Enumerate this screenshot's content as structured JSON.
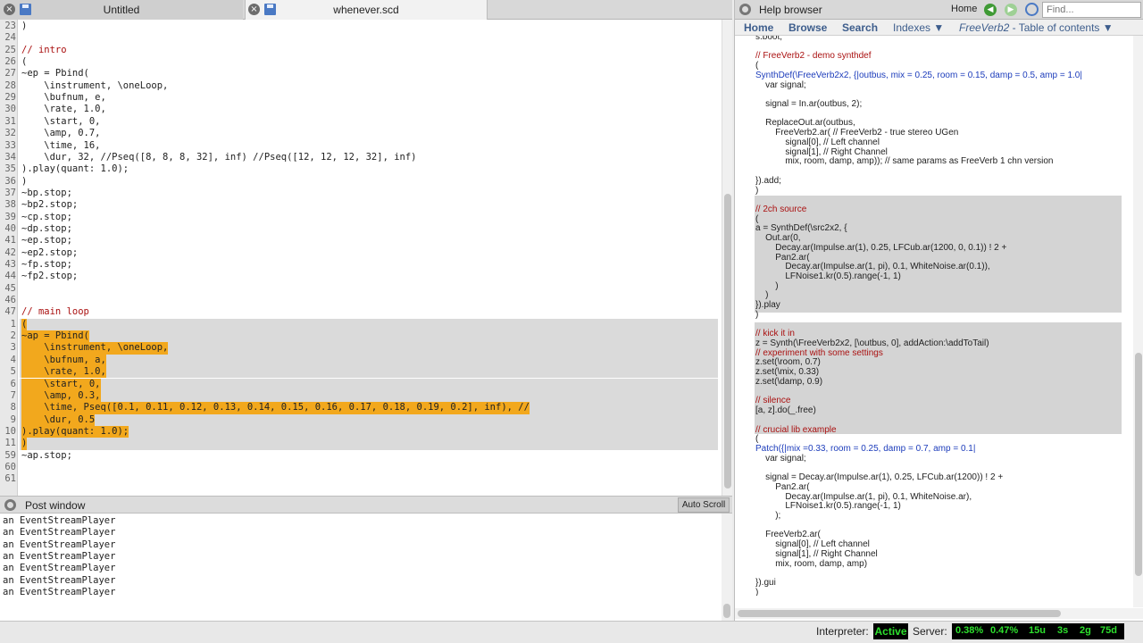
{
  "editor": {
    "tabs": [
      {
        "label": "Untitled"
      },
      {
        "label": "whenever.scd"
      }
    ],
    "lines": [
      {
        "n": "23",
        "t": ")"
      },
      {
        "n": "24",
        "t": ""
      },
      {
        "n": "25",
        "t": "// intro"
      },
      {
        "n": "26",
        "t": "("
      },
      {
        "n": "27",
        "t": "~ep = Pbind("
      },
      {
        "n": "28",
        "t": "    \\instrument, \\oneLoop,"
      },
      {
        "n": "29",
        "t": "    \\bufnum, e,"
      },
      {
        "n": "30",
        "t": "    \\rate, 1.0,"
      },
      {
        "n": "31",
        "t": "    \\start, 0,"
      },
      {
        "n": "32",
        "t": "    \\amp, 0.7,"
      },
      {
        "n": "33",
        "t": "    \\time, 16,"
      },
      {
        "n": "34",
        "t": "    \\dur, 32, //Pseq([8, 8, 8, 32], inf) //Pseq([12, 12, 12, 32], inf)"
      },
      {
        "n": "35",
        "t": ").play(quant: 1.0);"
      },
      {
        "n": "36",
        "t": ")"
      },
      {
        "n": "37",
        "t": "~bp.stop;"
      },
      {
        "n": "38",
        "t": "~bp2.stop;"
      },
      {
        "n": "39",
        "t": "~cp.stop;"
      },
      {
        "n": "40",
        "t": "~dp.stop;"
      },
      {
        "n": "41",
        "t": "~ep.stop;"
      },
      {
        "n": "42",
        "t": "~ep2.stop;"
      },
      {
        "n": "43",
        "t": "~fp.stop;"
      },
      {
        "n": "44",
        "t": "~fp2.stop;"
      },
      {
        "n": "45",
        "t": ""
      },
      {
        "n": "46",
        "t": ""
      },
      {
        "n": "47",
        "t": "// main loop"
      },
      {
        "n": "1",
        "t": "("
      },
      {
        "n": "2",
        "t": "~ap = Pbind("
      },
      {
        "n": "3",
        "t": "    \\instrument, \\oneLoop,"
      },
      {
        "n": "4",
        "t": "    \\bufnum, a,"
      },
      {
        "n": "5",
        "t": "    \\rate, 1.0,"
      },
      {
        "n": "6",
        "t": "    \\start, 0,"
      },
      {
        "n": "7",
        "t": "    \\amp, 0.3,"
      },
      {
        "n": "8",
        "t": "    \\time, Pseq([0.1, 0.11, 0.12, 0.13, 0.14, 0.15, 0.16, 0.17, 0.18, 0.19, 0.2], inf), //"
      },
      {
        "n": "9",
        "t": "    \\dur, 0.5"
      },
      {
        "n": "10",
        "t": ").play(quant: 1.0);"
      },
      {
        "n": "11",
        "t": ")"
      },
      {
        "n": "59",
        "t": "~ap.stop;"
      },
      {
        "n": "60",
        "t": ""
      },
      {
        "n": "61",
        "t": ""
      }
    ]
  },
  "post": {
    "title": "Post window",
    "autoscroll_label": "Auto Scroll",
    "lines": [
      "an EventStreamPlayer",
      "an EventStreamPlayer",
      "an EventStreamPlayer",
      "an EventStreamPlayer",
      "an EventStreamPlayer",
      "an EventStreamPlayer",
      "an EventStreamPlayer"
    ]
  },
  "help": {
    "title": "Help browser",
    "home_label": "Home",
    "find_placeholder": "Find...",
    "nav": {
      "home": "Home",
      "browse": "Browse",
      "search": "Search",
      "indexes": "Indexes ▼",
      "toc_class": "FreeVerb2",
      "toc_suffix": " - Table of contents ▼"
    },
    "lines": [
      "s.boot;",
      "",
      "// FreeVerb2 - demo synthdef",
      "(",
      "SynthDef(\\FreeVerb2x2, {|outbus, mix = 0.25, room = 0.15, damp = 0.5, amp = 1.0|",
      "    var signal;",
      "",
      "    signal = In.ar(outbus, 2);",
      "",
      "    ReplaceOut.ar(outbus,",
      "        FreeVerb2.ar( // FreeVerb2 - true stereo UGen",
      "            signal[0], // Left channel",
      "            signal[1], // Right Channel",
      "            mix, room, damp, amp)); // same params as FreeVerb 1 chn version",
      "",
      "}).add;",
      ")",
      "",
      "// 2ch source",
      "(",
      "a = SynthDef(\\src2x2, {",
      "    Out.ar(0,",
      "        Decay.ar(Impulse.ar(1), 0.25, LFCub.ar(1200, 0, 0.1)) ! 2 +",
      "        Pan2.ar(",
      "            Decay.ar(Impulse.ar(1, pi), 0.1, WhiteNoise.ar(0.1)),",
      "            LFNoise1.kr(0.5).range(-1, 1)",
      "        )",
      "    )",
      "}).play",
      ")",
      "",
      "// kick it in",
      "z = Synth(\\FreeVerb2x2, [\\outbus, 0], addAction:\\addToTail)",
      "// experiment with some settings",
      "z.set(\\room, 0.7)",
      "z.set(\\mix, 0.33)",
      "z.set(\\damp, 0.9)",
      "",
      "// silence",
      "[a, z].do(_.free)",
      "",
      "// crucial lib example",
      "(",
      "Patch({|mix =0.33, room = 0.25, damp = 0.7, amp = 0.1|",
      "    var signal;",
      "",
      "    signal = Decay.ar(Impulse.ar(1), 0.25, LFCub.ar(1200)) ! 2 +",
      "        Pan2.ar(",
      "            Decay.ar(Impulse.ar(1, pi), 0.1, WhiteNoise.ar),",
      "            LFNoise1.kr(0.5).range(-1, 1)",
      "        );",
      "",
      "    FreeVerb2.ar(",
      "        signal[0], // Left channel",
      "        signal[1], // Right Channel",
      "        mix, room, damp, amp)",
      "",
      "}).gui",
      ")"
    ]
  },
  "status": {
    "interpreter_label": "Interpreter:",
    "interpreter_state": "Active",
    "server_label": "Server:",
    "server_stats": [
      "0.38%",
      "0.47%",
      "15u",
      "3s",
      "2g",
      "75d"
    ]
  },
  "colors": {
    "selection": "#f2a81d",
    "active_text": "#2de02d",
    "keyword_blue": "#1c3cbb",
    "comment_red": "#a11"
  }
}
